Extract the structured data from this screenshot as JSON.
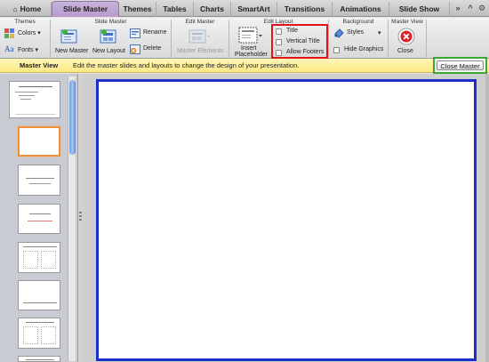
{
  "tabs": [
    {
      "label": "Home",
      "active": false
    },
    {
      "label": "Slide Master",
      "active": true
    },
    {
      "label": "Themes",
      "active": false
    },
    {
      "label": "Tables",
      "active": false
    },
    {
      "label": "Charts",
      "active": false
    },
    {
      "label": "SmartArt",
      "active": false
    },
    {
      "label": "Transitions",
      "active": false
    },
    {
      "label": "Animations",
      "active": false
    },
    {
      "label": "Slide Show",
      "active": false
    }
  ],
  "tab_controls": {
    "more": "»",
    "collapse": "^",
    "options": "⚙"
  },
  "ribbon": {
    "themes": {
      "title": "Themes",
      "colors": "Colors",
      "fonts": "Fonts",
      "fonts_glyph": "Aa"
    },
    "slide_master": {
      "title": "Slide Master",
      "new_master": "New Master",
      "new_layout": "New Layout",
      "rename": "Rename",
      "delete": "Delete"
    },
    "edit_master": {
      "title": "Edit Master",
      "master_elements": "Master Elements"
    },
    "edit_layout": {
      "title": "Edit Layout",
      "insert_placeholder_1": "Insert",
      "insert_placeholder_2": "Placeholder",
      "title_chk": "Title",
      "vertical_title_chk": "Vertical Title",
      "allow_footers_chk": "Allow Footers"
    },
    "background": {
      "title": "Background",
      "styles": "Styles",
      "hide_graphics": "Hide Graphics"
    },
    "master_view": {
      "title": "Master View",
      "close": "Close"
    }
  },
  "message_bar": {
    "label": "Master View",
    "text": "Edit the master slides and layouts to change the design of your presentation.",
    "close_button": "Close Master"
  },
  "colors": {
    "accent_purple": "#b79bcd",
    "highlight_red": "#e1141b",
    "highlight_green": "#39a935",
    "highlight_blue": "#1c2fc6",
    "thumb_selected": "#f0903a"
  }
}
